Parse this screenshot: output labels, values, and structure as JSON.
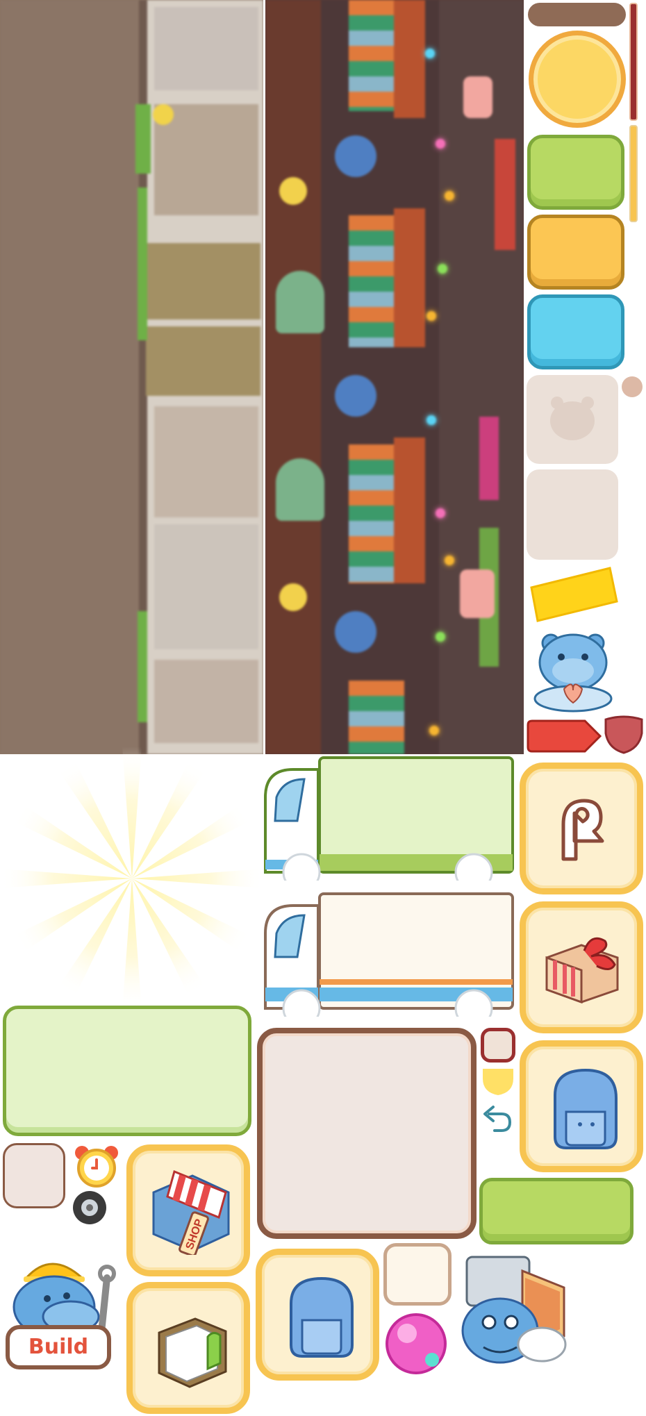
{
  "atlas": {
    "shop_sign_text": "SHOP",
    "build_label": "Build"
  },
  "colors": {
    "green_fill": "#b7d963",
    "green_border": "#7fa93b",
    "yellow_fill": "#fcc653",
    "yellow_border": "#b58422",
    "blue_fill": "#63d2ef",
    "blue_border": "#2f97b7",
    "brown_bar": "#8f6b56",
    "beige_panel": "#ebdfd8",
    "tile_border": "#f7c451",
    "tile_fill": "#fdf0cf",
    "red_tag": "#e8483d",
    "hippo_blue": "#66a9e0"
  },
  "icons": [
    "sun-rays-icon",
    "coin-icon",
    "hippo-silhouette-icon",
    "ribbon-banner-icon",
    "hippo-heart-mascot-icon",
    "red-tag-icon",
    "green-truck-icon",
    "white-truck-icon",
    "redo-arrow-icon",
    "gift-box-icon",
    "backpack-icon",
    "alarm-clock-icon",
    "tire-icon",
    "shop-building-icon",
    "undo-arrow-icon",
    "book-icon",
    "hippo-builder-icon",
    "gumball-icon",
    "robot-hippo-icon"
  ]
}
